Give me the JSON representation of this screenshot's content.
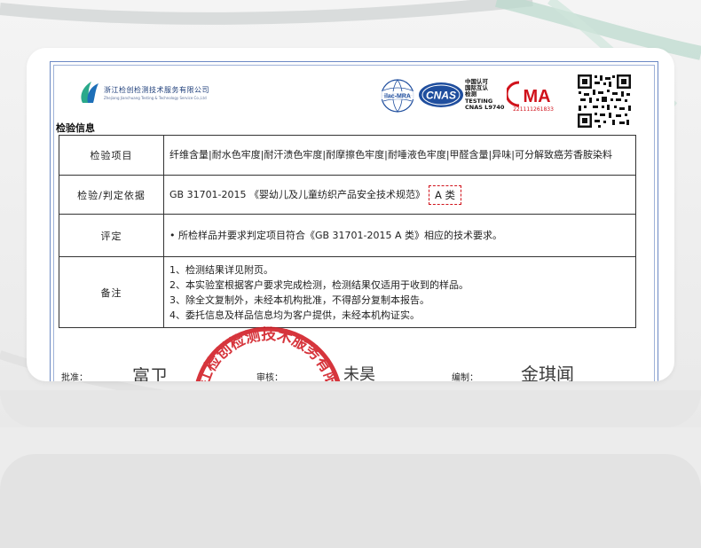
{
  "header": {
    "logo_cn": "浙江检创检测技术服务有限公司",
    "logo_en": "Zhejiang Jianchuang Testing & Technology Service Co.,Ltd",
    "ilac_text": "ilac-MRA",
    "cnas_logo": "CNAS",
    "cnas_lines": [
      "中国认可",
      "国际互认",
      "检测",
      "TESTING",
      "CNAS L9740"
    ],
    "cma_logo": "MA",
    "cma_number": "221111261833"
  },
  "section_title": "检验信息",
  "table": {
    "rows": [
      {
        "label": "检验项目",
        "value": "纤维含量|耐水色牢度|耐汗渍色牢度|耐摩擦色牢度|耐唾液色牢度|甲醛含量|异味|可分解致癌芳香胺染料"
      },
      {
        "label": "检验/判定依据",
        "value": "GB 31701-2015 《婴幼儿及儿童纺织产品安全技术规范》",
        "grade": "A 类"
      },
      {
        "label": "评定",
        "value": "• 所检样品并要求判定项目符合《GB 31701-2015 A 类》相应的技术要求。"
      },
      {
        "label": "备注",
        "notes": [
          "1、检测结果详见附页。",
          "2、本实验室根据客户要求完成检测，检测结果仅适用于收到的样品。",
          "3、除全文复制外，未经本机构批准，不得部分复制本报告。",
          "4、委托信息及样品信息均为客户提供，未经本机构证实。"
        ]
      }
    ]
  },
  "signatures": {
    "approve_label": "批准：",
    "approve_sign": "富卫",
    "review_label": "审核：",
    "review_sign": "未昊",
    "compile_label": "编制：",
    "compile_sign": "金琪闻"
  },
  "stamp_text": "浙江检创检测技术服务有限公司",
  "colors": {
    "frame": "#6b89c4",
    "stamp": "#d0121b",
    "grade_box": "#d0121b"
  }
}
